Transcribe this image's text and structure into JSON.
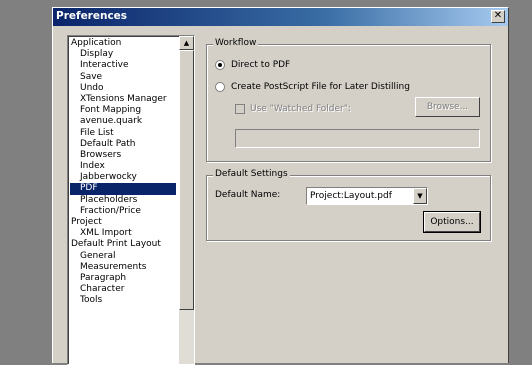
{
  "window": {
    "title": "Preferences",
    "close_icon": "✕"
  },
  "tree": {
    "items": [
      {
        "label": "Application",
        "child": false
      },
      {
        "label": "Display",
        "child": true
      },
      {
        "label": "Interactive",
        "child": true
      },
      {
        "label": "Save",
        "child": true
      },
      {
        "label": "Undo",
        "child": true
      },
      {
        "label": "XTensions Manager",
        "child": true
      },
      {
        "label": "Font Mapping",
        "child": true
      },
      {
        "label": "avenue.quark",
        "child": true
      },
      {
        "label": "File List",
        "child": true
      },
      {
        "label": "Default Path",
        "child": true
      },
      {
        "label": "Browsers",
        "child": true
      },
      {
        "label": "Index",
        "child": true
      },
      {
        "label": "Jabberwocky",
        "child": true
      },
      {
        "label": "PDF",
        "child": true,
        "selected": true
      },
      {
        "label": "Placeholders",
        "child": true
      },
      {
        "label": "Fraction/Price",
        "child": true
      },
      {
        "label": "Project",
        "child": false
      },
      {
        "label": "XML Import",
        "child": true
      },
      {
        "label": "Default Print Layout",
        "child": false
      },
      {
        "label": "General",
        "child": true
      },
      {
        "label": "Measurements",
        "child": true
      },
      {
        "label": "Paragraph",
        "child": true
      },
      {
        "label": "Character",
        "child": true
      },
      {
        "label": "Tools",
        "child": true
      }
    ]
  },
  "workflow": {
    "title": "Workflow",
    "direct_pdf": "Direct to PDF",
    "create_ps": "Create PostScript File for Later Distilling",
    "use_watched": "Use \"Watched Folder\":",
    "browse": "Browse..."
  },
  "default_settings": {
    "title": "Default Settings",
    "name_label": "Default Name:",
    "name_value": "Project:Layout.pdf",
    "options": "Options..."
  }
}
